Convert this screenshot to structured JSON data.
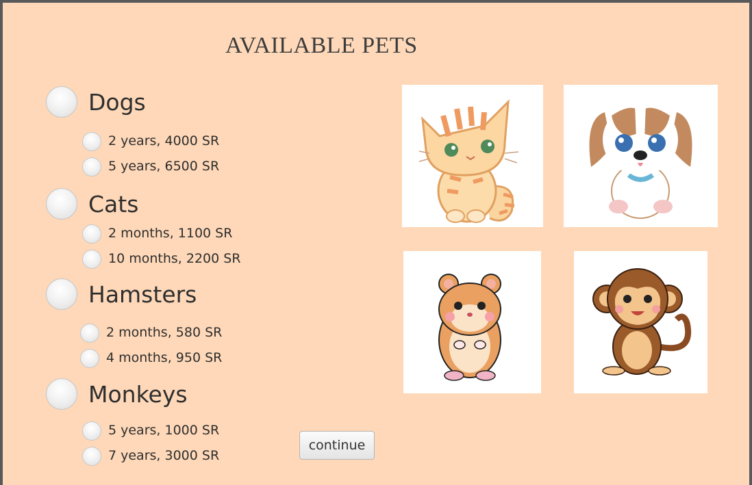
{
  "page": {
    "title": "AVAILABLE PETS"
  },
  "categories": [
    {
      "label": "Dogs",
      "options": [
        "2 years, 4000 SR",
        "5 years, 6500 SR"
      ]
    },
    {
      "label": "Cats",
      "options": [
        "2 months, 1100 SR",
        "10 months, 2200 SR"
      ]
    },
    {
      "label": "Hamsters",
      "options": [
        "2 months, 580 SR",
        "4 months, 950 SR"
      ]
    },
    {
      "label": "Monkeys",
      "options": [
        "5 years, 1000 SR",
        "7 years, 3000 SR"
      ]
    }
  ],
  "actions": {
    "continue_label": "continue"
  },
  "images": [
    {
      "icon": "cat-icon"
    },
    {
      "icon": "dog-icon"
    },
    {
      "icon": "hamster-icon"
    },
    {
      "icon": "monkey-icon"
    }
  ],
  "colors": {
    "background": "#fed8b8",
    "frame": "#595959"
  }
}
